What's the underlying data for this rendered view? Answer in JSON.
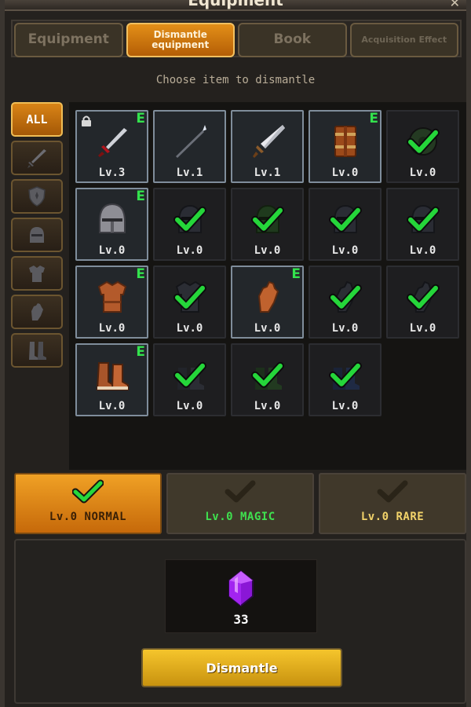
{
  "window": {
    "title": "Equipment",
    "close_icon": "close-icon"
  },
  "tabs": [
    {
      "label": "Equipment",
      "active": false
    },
    {
      "label": "Dismantle equipment",
      "active": true
    },
    {
      "label": "Book",
      "active": false
    },
    {
      "label": "Acquisition Effect",
      "active": false
    }
  ],
  "instruction": "Choose item to dismantle",
  "categories": [
    {
      "label": "ALL",
      "icon": "all",
      "active": true
    },
    {
      "label": "",
      "icon": "sword-icon"
    },
    {
      "label": "",
      "icon": "shield-icon"
    },
    {
      "label": "",
      "icon": "helmet-icon"
    },
    {
      "label": "",
      "icon": "armor-icon"
    },
    {
      "label": "",
      "icon": "gauntlet-icon"
    },
    {
      "label": "",
      "icon": "boots-icon"
    }
  ],
  "items": [
    {
      "level": "Lv.3",
      "icon": "red-sword-icon",
      "equipped": true,
      "locked": true,
      "checked": false
    },
    {
      "level": "Lv.1",
      "icon": "spear-icon",
      "equipped": false,
      "locked": false,
      "checked": false
    },
    {
      "level": "Lv.1",
      "icon": "broadsword-icon",
      "equipped": false,
      "locked": false,
      "checked": false
    },
    {
      "level": "Lv.0",
      "icon": "wooden-shield-icon",
      "equipped": true,
      "locked": false,
      "checked": false
    },
    {
      "level": "Lv.0",
      "icon": "dark-shield-icon",
      "equipped": false,
      "locked": false,
      "checked": true
    },
    {
      "level": "Lv.0",
      "icon": "iron-helmet-icon",
      "equipped": true,
      "locked": false,
      "checked": false
    },
    {
      "level": "Lv.0",
      "icon": "dark-helmet-icon",
      "equipped": false,
      "locked": false,
      "checked": true
    },
    {
      "level": "Lv.0",
      "icon": "green-helmet-icon",
      "equipped": false,
      "locked": false,
      "checked": true
    },
    {
      "level": "Lv.0",
      "icon": "dark-helmet-icon",
      "equipped": false,
      "locked": false,
      "checked": true
    },
    {
      "level": "Lv.0",
      "icon": "dark-helmet-icon",
      "equipped": false,
      "locked": false,
      "checked": true
    },
    {
      "level": "Lv.0",
      "icon": "leather-armor-icon",
      "equipped": true,
      "locked": false,
      "checked": false
    },
    {
      "level": "Lv.0",
      "icon": "dark-armor-icon",
      "equipped": false,
      "locked": false,
      "checked": true
    },
    {
      "level": "Lv.0",
      "icon": "leather-gauntlet-icon",
      "equipped": true,
      "locked": false,
      "checked": false
    },
    {
      "level": "Lv.0",
      "icon": "dark-gauntlet-icon",
      "equipped": false,
      "locked": false,
      "checked": true
    },
    {
      "level": "Lv.0",
      "icon": "dark-gauntlet-icon",
      "equipped": false,
      "locked": false,
      "checked": true
    },
    {
      "level": "Lv.0",
      "icon": "leather-boots-icon",
      "equipped": true,
      "locked": false,
      "checked": false
    },
    {
      "level": "Lv.0",
      "icon": "dark-boots-icon",
      "equipped": false,
      "locked": false,
      "checked": true
    },
    {
      "level": "Lv.0",
      "icon": "green-boots-icon",
      "equipped": false,
      "locked": false,
      "checked": true
    },
    {
      "level": "Lv.0",
      "icon": "blue-boots-icon",
      "equipped": false,
      "locked": false,
      "checked": true
    }
  ],
  "equipped_badge": "E",
  "filters": [
    {
      "label": "Lv.0 NORMAL",
      "checked": true,
      "color": "#ffffff"
    },
    {
      "label": "Lv.0 MAGIC",
      "checked": false,
      "color": "#3fe04f"
    },
    {
      "label": "Lv.0 RARE",
      "checked": false,
      "color": "#f2d36a"
    }
  ],
  "reward": {
    "icon": "purple-gem-icon",
    "count": "33"
  },
  "dismantle_button": {
    "label": "Dismantle"
  },
  "colors": {
    "check_green": "#25d63a",
    "accent_orange": "#e08a16",
    "gold": "#f5c52c"
  }
}
